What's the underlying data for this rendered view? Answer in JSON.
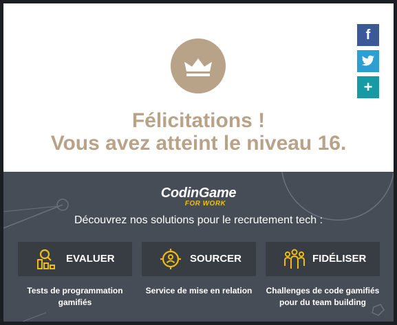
{
  "modal": {
    "headline_line1": "Félicitations !",
    "headline_line2": "Vous avez atteint le niveau 16.",
    "badge_icon": "crown-icon"
  },
  "share": {
    "facebook_label": "f",
    "twitter_icon": "twitter-bird-icon",
    "more_label": "+"
  },
  "promo": {
    "logo_text": "CodinGame",
    "logo_subtext": "FOR WORK",
    "tagline": "Découvrez nos solutions pour le recrutement tech :",
    "solutions": [
      {
        "label": "EVALUER",
        "icon": "assessment-chart-icon",
        "description": "Tests de programmation gamifiés"
      },
      {
        "label": "SOURCER",
        "icon": "target-user-icon",
        "description": "Service de mise en relation"
      },
      {
        "label": "FIDÉLISER",
        "icon": "team-icon",
        "description": "Challenges de code gamifiés pour du team building"
      }
    ]
  },
  "colors": {
    "accent_gold": "#b8a288",
    "yellow": "#f2bb13",
    "panel_bg": "#474d57",
    "button_bg": "#383c43",
    "facebook": "#3b5998",
    "twitter": "#2b9fd2",
    "share_more": "#169aa3"
  }
}
